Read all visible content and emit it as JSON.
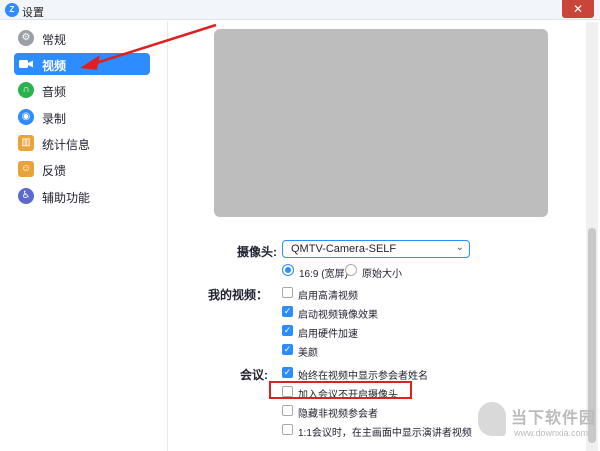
{
  "window": {
    "title": "设置",
    "app_icon": "zoom-logo-icon",
    "close_glyph": "✕"
  },
  "sidebar": {
    "items": [
      {
        "label": "常规",
        "icon": "gear-icon",
        "color": "#9aa0a6",
        "glyph": "⚙",
        "active": false
      },
      {
        "label": "视频",
        "icon": "video-camera-icon",
        "color": "#2d8cff",
        "glyph": "▶",
        "active": true
      },
      {
        "label": "音频",
        "icon": "headphones-icon",
        "color": "#2bb24c",
        "glyph": "∩",
        "active": false
      },
      {
        "label": "录制",
        "icon": "record-icon",
        "color": "#2d8cff",
        "glyph": "◉",
        "active": false
      },
      {
        "label": "统计信息",
        "icon": "statistics-icon",
        "color": "#e8a43a",
        "glyph": "▥",
        "active": false
      },
      {
        "label": "反馈",
        "icon": "feedback-icon",
        "color": "#e8a43a",
        "glyph": "☺",
        "active": false
      },
      {
        "label": "辅助功能",
        "icon": "accessibility-icon",
        "color": "#5b6acf",
        "glyph": "♿",
        "active": false
      }
    ]
  },
  "video": {
    "camera_label": "摄像头:",
    "camera_value": "QMTV-Camera-SELF",
    "camera_caret": "⌄",
    "aspect_options": [
      {
        "label": "16:9 (宽屏)",
        "selected": true
      },
      {
        "label": "原始大小",
        "selected": false
      }
    ],
    "my_video_label": "我的视频：",
    "my_video_options": [
      {
        "label": "启用高清视频",
        "checked": false
      },
      {
        "label": "启动视频镜像效果",
        "checked": true
      },
      {
        "label": "启用硬件加速",
        "checked": true
      },
      {
        "label": "美颜",
        "checked": true
      }
    ],
    "meeting_label": "会议:",
    "meeting_options": [
      {
        "label": "始终在视频中显示参会者姓名",
        "checked": true
      },
      {
        "label": "加入会议不开启摄像头",
        "checked": false
      },
      {
        "label": "隐藏非视频参会者",
        "checked": false
      },
      {
        "label": "1:1会议时，在主画面中显示演讲者视频",
        "checked": false
      }
    ]
  },
  "watermark": {
    "name": "当下软件园",
    "url": "www.downxia.com"
  },
  "colors": {
    "accent": "#2d8cff",
    "highlight": "#e02020",
    "preview": "#bdbdbd"
  }
}
